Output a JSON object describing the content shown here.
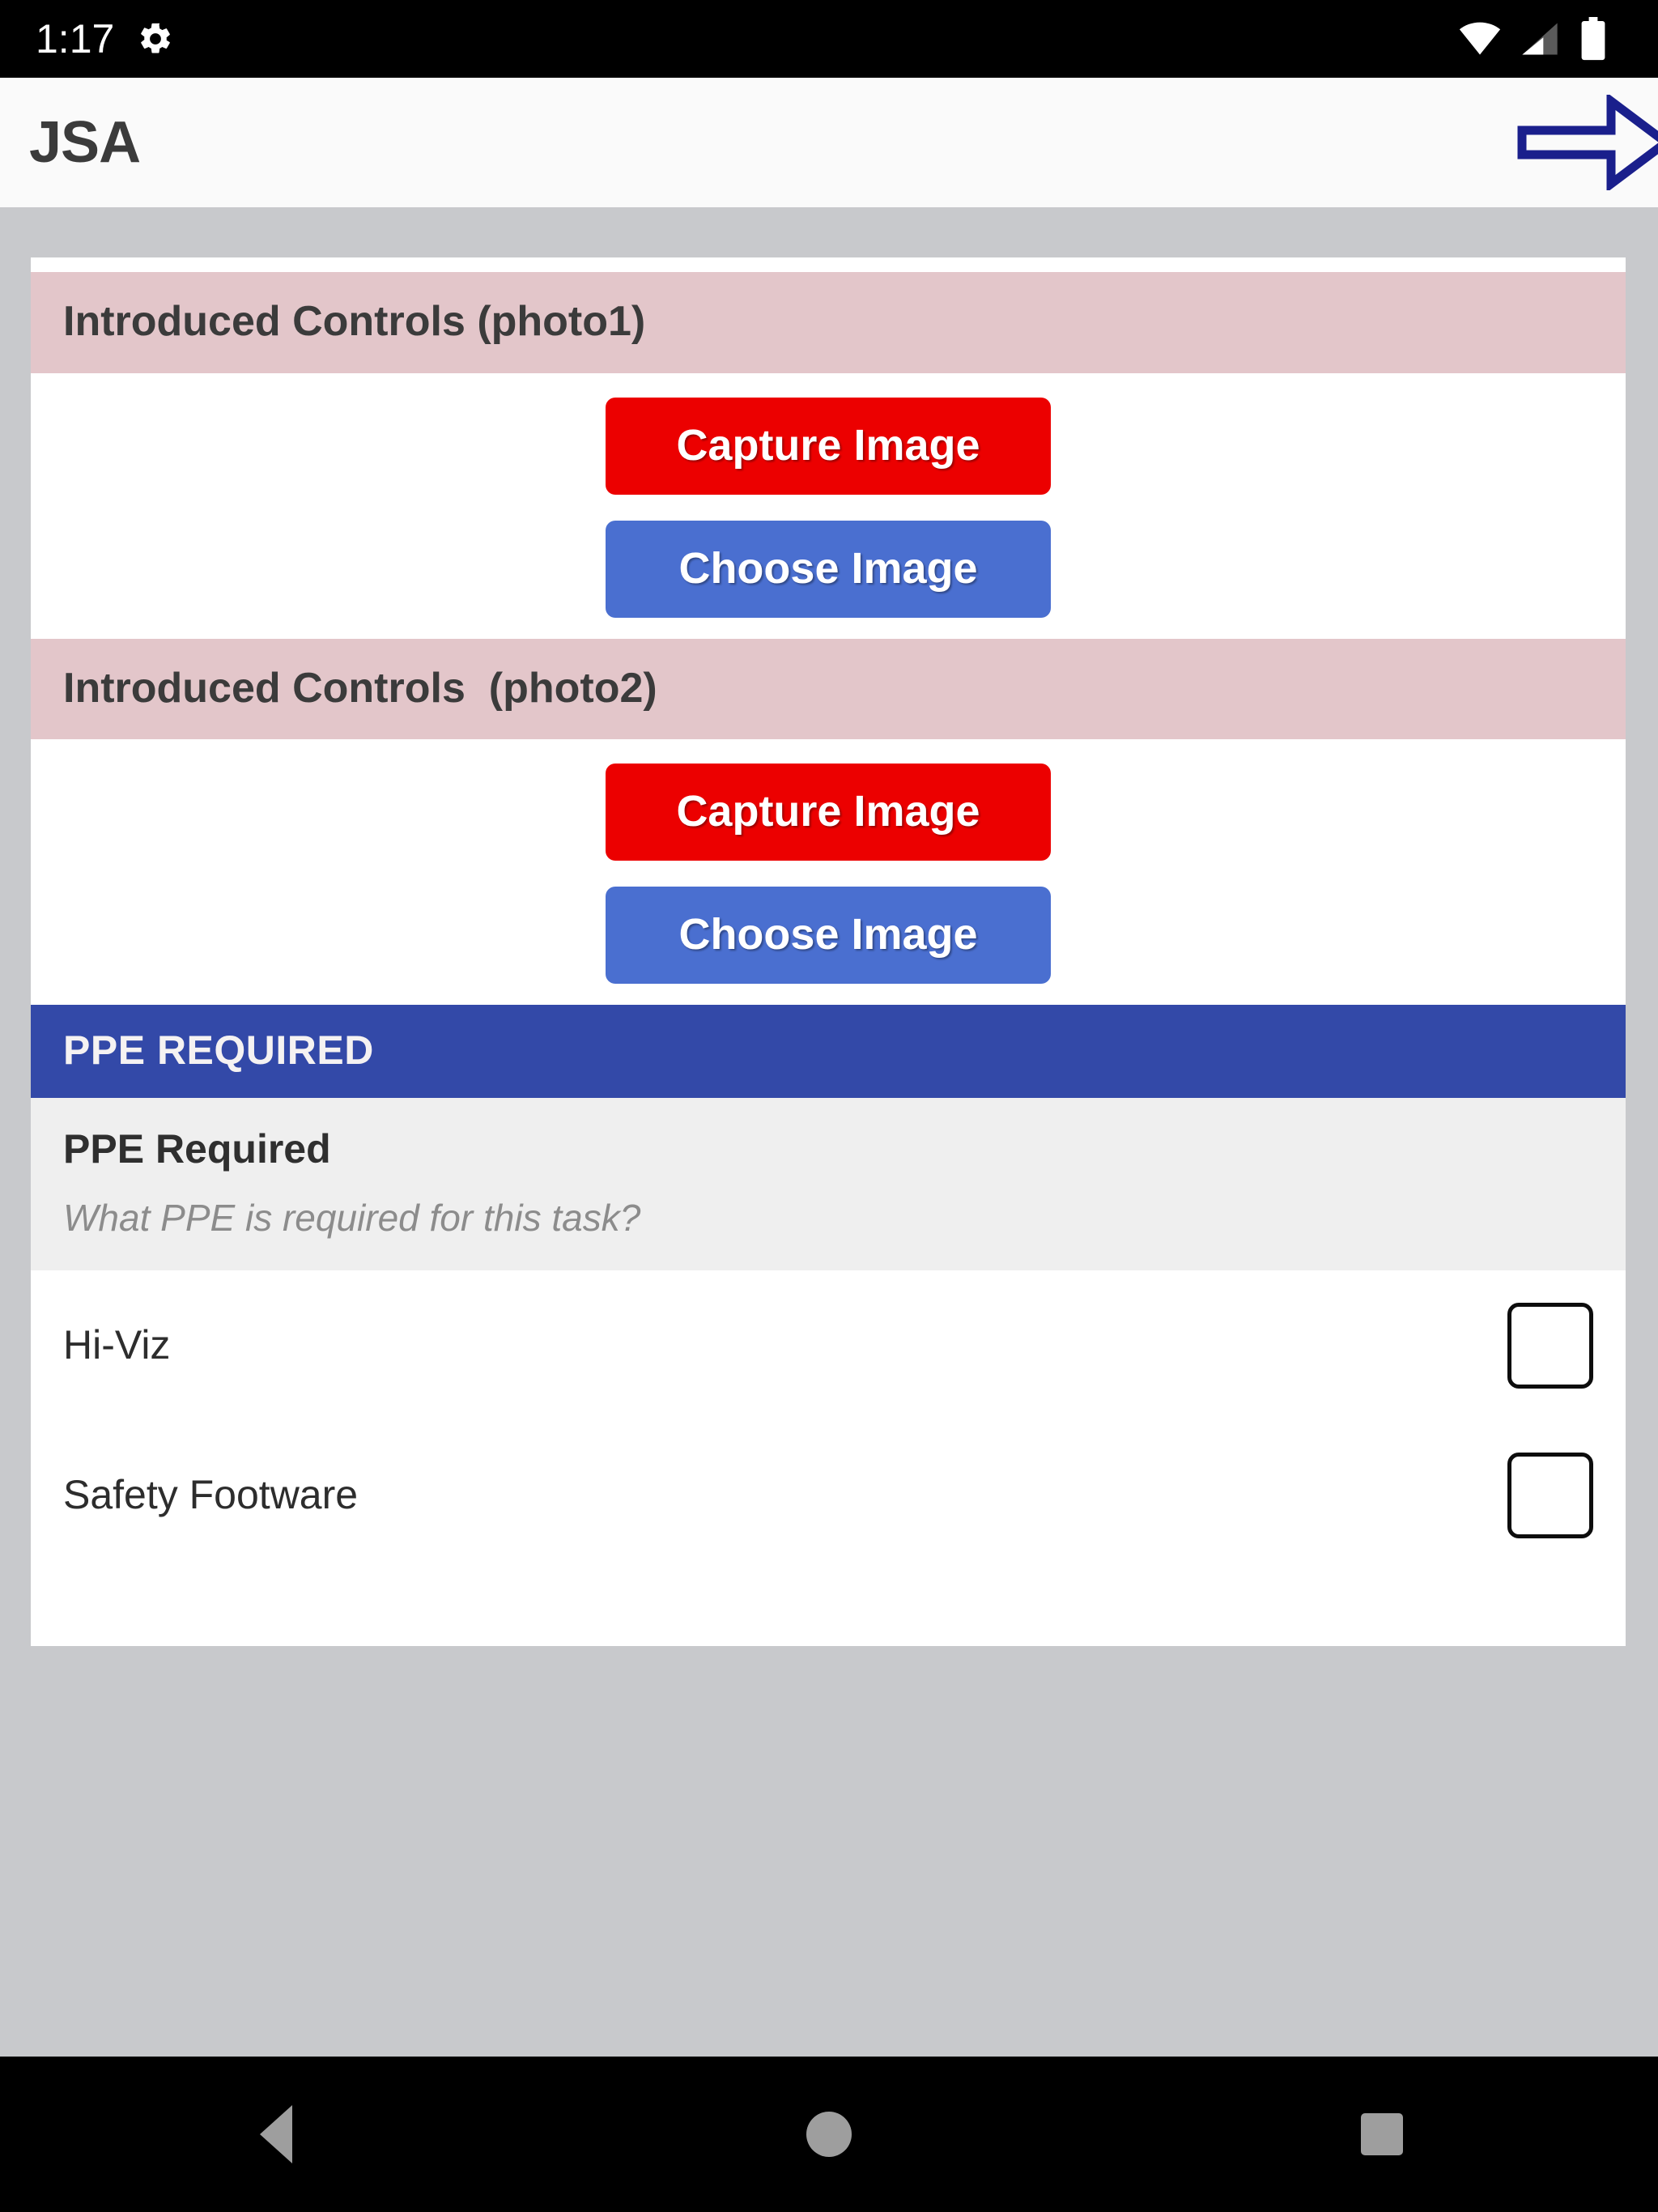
{
  "status_bar": {
    "clock": "1:17",
    "icons": {
      "settings": "gear-icon",
      "wifi": "wifi-icon",
      "cellular": "cellular-signal-icon",
      "battery": "battery-full-icon"
    }
  },
  "app_bar": {
    "title": "JSA",
    "next_action": "next-arrow-icon"
  },
  "sections": [
    {
      "header": "Introduced Controls (photo1)",
      "header_style": "pink",
      "buttons": [
        {
          "label": "Capture Image",
          "style": "capture"
        },
        {
          "label": "Choose Image",
          "style": "choose"
        }
      ]
    },
    {
      "header": "Introduced Controls  (photo2)",
      "header_style": "pink",
      "buttons": [
        {
          "label": "Capture Image",
          "style": "capture"
        },
        {
          "label": "Choose Image",
          "style": "choose"
        }
      ]
    }
  ],
  "ppe_section": {
    "header": "PPE REQUIRED",
    "title": "PPE Required",
    "subtitle": "What PPE is required for this task?",
    "items": [
      {
        "label": "Hi-Viz",
        "checked": false
      },
      {
        "label": "Safety Footware",
        "checked": false
      }
    ]
  },
  "nav_bar": {
    "back": "back-triangle-icon",
    "home": "home-circle-icon",
    "recents": "recents-square-icon"
  },
  "colors": {
    "page_background": "#c8c9cc",
    "app_bar_background": "#fafafa",
    "section_pink": "#e3c6ca",
    "section_blue": "#3349a8",
    "capture_red": "#ec0000",
    "choose_blue": "#4a6fd0",
    "ppe_info_background": "#efefef",
    "arrow_navy": "#1a1f8c",
    "status_bar": "#000000"
  }
}
